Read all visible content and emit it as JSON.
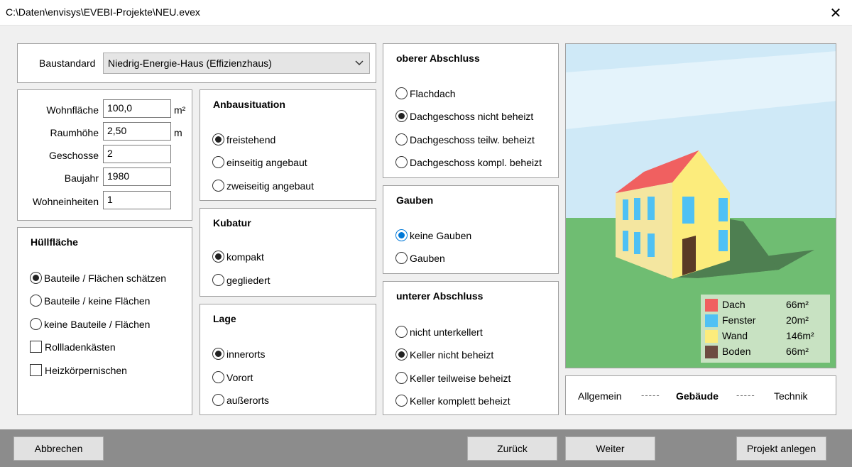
{
  "window": {
    "title": "C:\\Daten\\envisys\\EVEBI-Projekte\\NEU.evex",
    "close_glyph": "✕"
  },
  "baustandard": {
    "label": "Baustandard",
    "value": "Niedrig-Energie-Haus (Effizienzhaus)"
  },
  "geometry": {
    "wohnflaeche": {
      "label": "Wohnfläche",
      "value": "100,0",
      "unit": "m²"
    },
    "raumhoehe": {
      "label": "Raumhöhe",
      "value": "2,50",
      "unit": "m"
    },
    "geschosse": {
      "label": "Geschosse",
      "value": "2"
    },
    "baujahr": {
      "label": "Baujahr",
      "value": "1980"
    },
    "wohneinheiten": {
      "label": "Wohneinheiten",
      "value": "1"
    }
  },
  "huellflaeche": {
    "title": "Hüllfläche",
    "options": [
      "Bauteile / Flächen schätzen",
      "Bauteile / keine Flächen",
      "keine Bauteile / Flächen"
    ],
    "selected": 0,
    "checkboxes": [
      {
        "label": "Rollladenkästen",
        "checked": false
      },
      {
        "label": "Heizkörpernischen",
        "checked": false
      }
    ]
  },
  "anbausituation": {
    "title": "Anbausituation",
    "options": [
      "freistehend",
      "einseitig angebaut",
      "zweiseitig angebaut"
    ],
    "selected": 0
  },
  "kubatur": {
    "title": "Kubatur",
    "options": [
      "kompakt",
      "gegliedert"
    ],
    "selected": 0
  },
  "lage": {
    "title": "Lage",
    "options": [
      "innerorts",
      "Vorort",
      "außerorts"
    ],
    "selected": 0
  },
  "oberer_abschluss": {
    "title": "oberer Abschluss",
    "options": [
      "Flachdach",
      "Dachgeschoss nicht beheizt",
      "Dachgeschoss teilw. beheizt",
      "Dachgeschoss kompl. beheizt"
    ],
    "selected": 1
  },
  "gauben": {
    "title": "Gauben",
    "options": [
      "keine Gauben",
      "Gauben"
    ],
    "selected": 0
  },
  "unterer_abschluss": {
    "title": "unterer Abschluss",
    "options": [
      "nicht unterkellert",
      "Keller nicht beheizt",
      "Keller teilweise beheizt",
      "Keller komplett beheizt"
    ],
    "selected": 1
  },
  "legend": [
    {
      "name": "Dach",
      "value": "66m²",
      "color": "#f06060"
    },
    {
      "name": "Fenster",
      "value": "20m²",
      "color": "#4fc1f4"
    },
    {
      "name": "Wand",
      "value": "146m²",
      "color": "#fcec7c"
    },
    {
      "name": "Boden",
      "value": "66m²",
      "color": "#6d4c41"
    }
  ],
  "colors": {
    "sky": "#cfe9f7",
    "grass": "#6fbd72",
    "shadow": "#4e7f51",
    "wall_side": "#f4e6a0",
    "door": "#5a3a26"
  },
  "steps": {
    "allgemein": "Allgemein",
    "gebaeude": "Gebäude",
    "technik": "Technik",
    "separator": "-----"
  },
  "buttons": {
    "abbrechen": "Abbrechen",
    "zurueck": "Zurück",
    "weiter": "Weiter",
    "projekt_anlegen": "Projekt anlegen"
  }
}
